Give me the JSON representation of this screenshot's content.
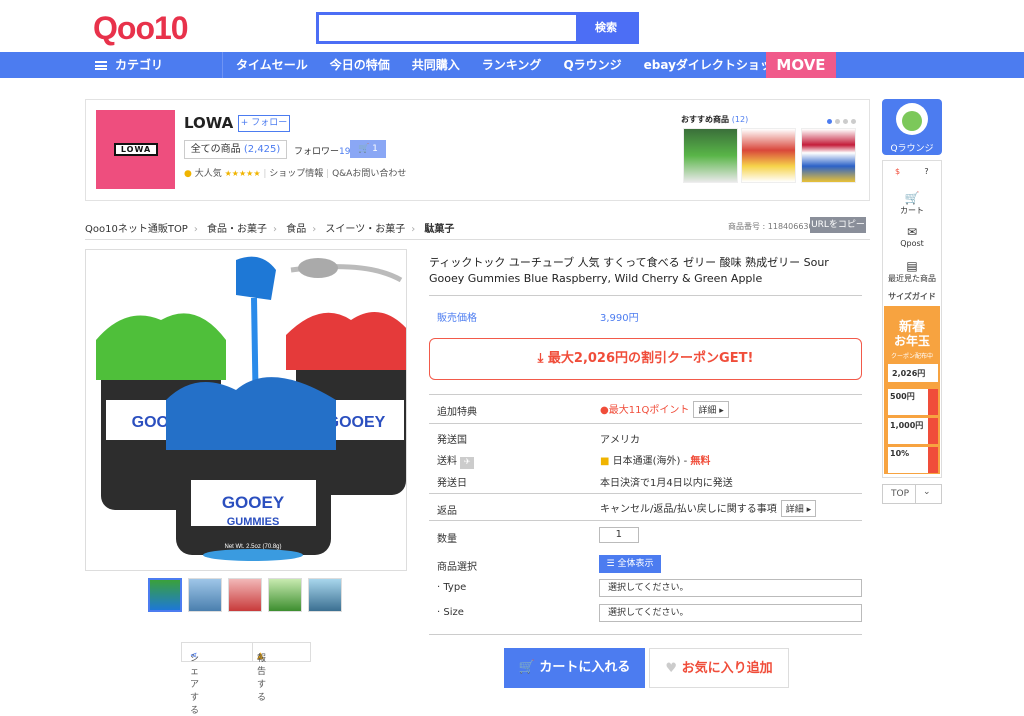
{
  "header": {
    "logo": "Qoo10",
    "search_placeholder": "",
    "search_button": "検索"
  },
  "nav": {
    "category": "カテゴリ",
    "items": [
      "タイムセール",
      "今日の特価",
      "共同購入",
      "ランキング",
      "Qラウンジ",
      "ebayダイレクトショップ"
    ],
    "move": "MOVE"
  },
  "shop": {
    "logo_text": "LOWA",
    "name": "LOWA",
    "follow": "+ フォロー",
    "all_products_label": "全ての商品",
    "all_products_count": "(2,425)",
    "followers_label": "フォロワー",
    "followers_count": "194",
    "cart_count": "1",
    "popularity": "大人気",
    "stars": "★★★★★",
    "shop_info": "ショップ情報",
    "qa": "Q&Aお問い合わせ",
    "recommended_label": "おすすめ商品",
    "recommended_count": "(12)"
  },
  "breadcrumb": [
    "Qoo10ネット通販TOP",
    "食品・お菓子",
    "食品",
    "スイーツ・お菓子",
    "駄菓子"
  ],
  "product_number": "商品番号 : 1184066308",
  "copy_url": "URLをコピー",
  "product": {
    "title": "ティックトック ユーチューブ 人気 すくって食べる ゼリー 酸味 熟成ゼリー Sour Gooey Gummies Blue Raspberry, Wild Cherry & Green Apple",
    "price_label": "販売価格",
    "price": "3,990円",
    "coupon": "最大2,026円の割引クーポンGET!",
    "extra_label": "追加特典",
    "extra_value": "最大11Qポイント",
    "detail": "詳細",
    "ship_country_label": "発送国",
    "ship_country": "アメリカ",
    "shipping_label": "送料",
    "shipping_value": "日本通運(海外) -",
    "shipping_free": "無料",
    "ship_date_label": "発送日",
    "ship_date": "本日決済で1月4日以内に発送",
    "return_label": "返品",
    "return_value": "キャンセル/返品/払い戻しに関する事項",
    "qty_label": "数量",
    "qty": "1",
    "select_label": "商品選択",
    "show_all": "全体表示",
    "type_label": "· Type",
    "size_label": "· Size",
    "select_placeholder": "選択してください。",
    "cart": "カートに入れる",
    "fav": "お気に入り追加"
  },
  "image": {
    "jar_text1": "GOOEY",
    "jar_text2": "GUMMIES",
    "weight": "Net Wt. 2.5oz (70.8g)"
  },
  "share": "シェアする",
  "report": "報告する",
  "sidebar": {
    "qlounge": "Qラウンジ",
    "cart": "カート",
    "qpost": "Qpost",
    "recent": "最近見た商品",
    "size_guide": "サイズガイド",
    "newyear1": "新春",
    "newyear2": "お年玉",
    "newyear3": "クーポン配布中",
    "coupon1": "2,026円",
    "coupon2": "500円",
    "coupon3": "1,000円",
    "coupon4": "10%",
    "top": "TOP"
  }
}
